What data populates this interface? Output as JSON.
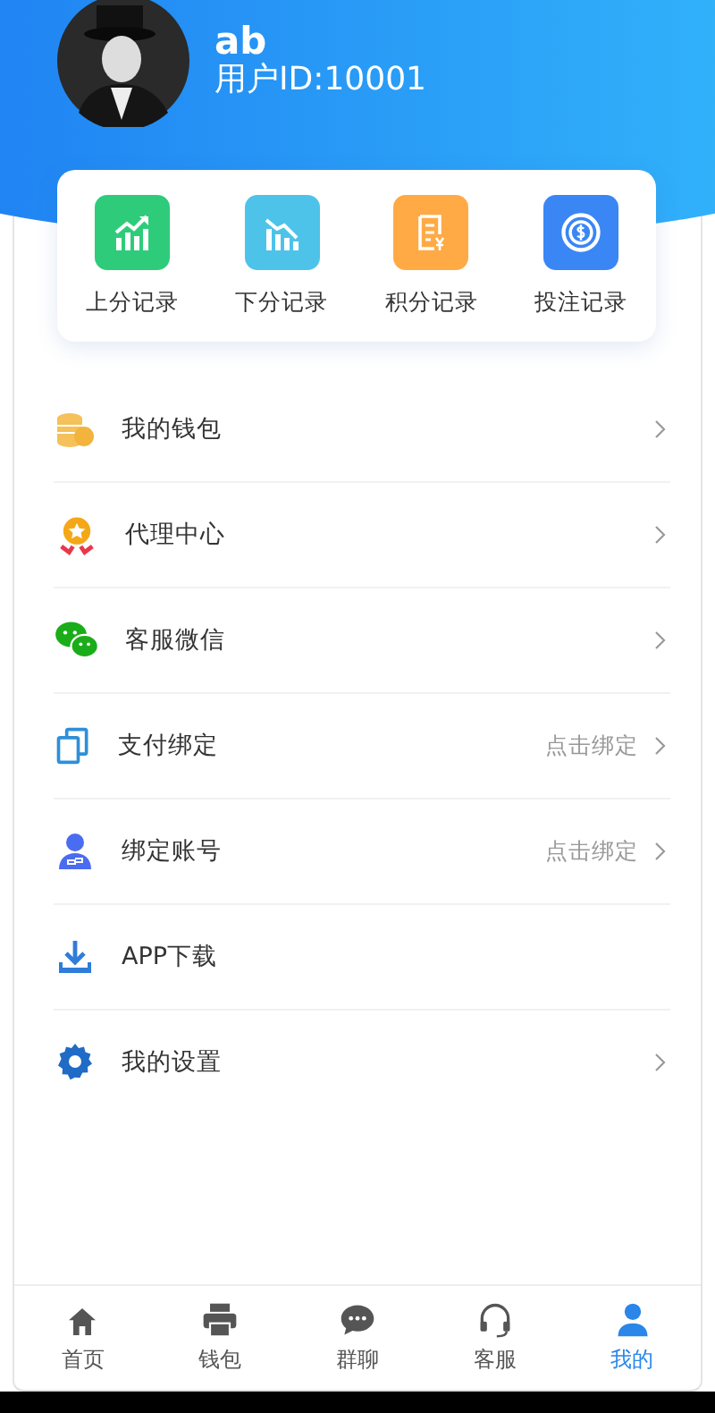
{
  "profile": {
    "name": "ab",
    "user_id": "用户ID:10001"
  },
  "records": [
    {
      "label": "上分记录",
      "kind": "up",
      "color": "#2ecc7a"
    },
    {
      "label": "下分记录",
      "kind": "down",
      "color": "#4ec3ea"
    },
    {
      "label": "积分记录",
      "kind": "points",
      "color": "#ffaa44"
    },
    {
      "label": "投注记录",
      "kind": "bet",
      "color": "#3a86f5"
    }
  ],
  "menu": [
    {
      "label": "我的钱包",
      "kind": "wallet",
      "chevron": true
    },
    {
      "label": "代理中心",
      "kind": "agent",
      "chevron": true
    },
    {
      "label": "客服微信",
      "kind": "wechat",
      "chevron": true
    },
    {
      "label": "支付绑定",
      "kind": "bind",
      "hint": "点击绑定",
      "chevron": true
    },
    {
      "label": "绑定账号",
      "kind": "account",
      "hint": "点击绑定",
      "chevron": true
    },
    {
      "label": "APP下载",
      "kind": "download",
      "chevron": false
    },
    {
      "label": "我的设置",
      "kind": "settings",
      "chevron": true
    }
  ],
  "tabs": [
    {
      "label": "首页",
      "kind": "home",
      "selected": false
    },
    {
      "label": "钱包",
      "kind": "wallet",
      "selected": false
    },
    {
      "label": "群聊",
      "kind": "chat",
      "selected": false
    },
    {
      "label": "客服",
      "kind": "support",
      "selected": false
    },
    {
      "label": "我的",
      "kind": "me",
      "selected": true
    }
  ]
}
